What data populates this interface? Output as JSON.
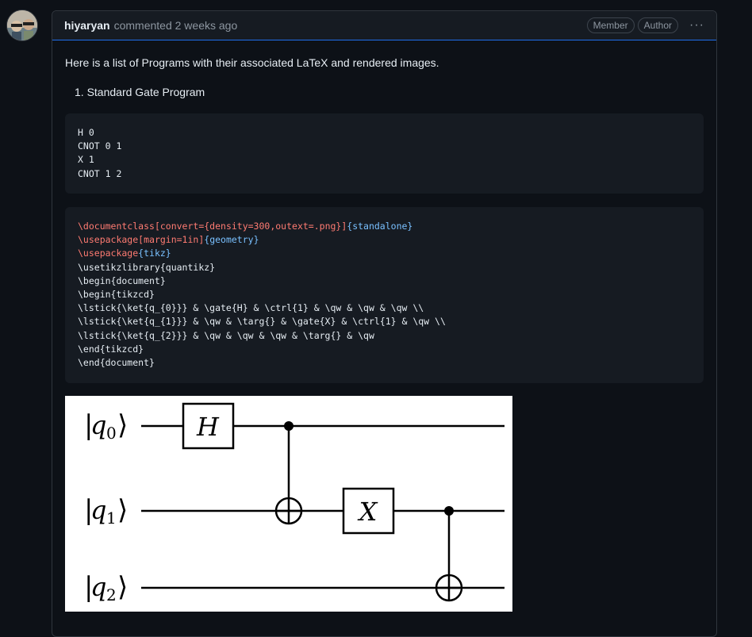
{
  "comment": {
    "author": "hiyaryan",
    "action": "commented 2 weeks ago",
    "badges": [
      "Member",
      "Author"
    ],
    "menu_icon": "kebab-horizontal-icon"
  },
  "body": {
    "intro": "Here is a list of Programs with their associated LaTeX and rendered images.",
    "list_item": "1. Standard Gate Program",
    "program_lines": [
      "H 0",
      "CNOT 0 1",
      "X 1",
      "CNOT 1 2"
    ]
  },
  "latex": {
    "l1_cmd": "\\documentclass",
    "l1_opt": "[convert={density=300,outext=.png}]",
    "l1_arg": "{standalone}",
    "l2_cmd": "\\usepackage",
    "l2_opt": "[margin=1in]",
    "l2_arg": "{geometry}",
    "l3_cmd": "\\usepackage",
    "l3_arg": "{tikz}",
    "l4": "\\usetikzlibrary{quantikz}",
    "l5": "\\begin{document}",
    "l6": "\\begin{tikzcd}",
    "l7": "\\lstick{\\ket{q_{0}}} & \\gate{H} & \\ctrl{1} & \\qw & \\qw & \\qw \\\\",
    "l8": "\\lstick{\\ket{q_{1}}} & \\qw & \\targ{} & \\gate{X} & \\ctrl{1} & \\qw \\\\",
    "l9": "\\lstick{\\ket{q_{2}}} & \\qw & \\qw & \\qw & \\targ{} & \\qw",
    "l10": "\\end{tikzcd}",
    "l11": "\\end{document}"
  },
  "circuit": {
    "qubits": [
      "q0",
      "q1",
      "q2"
    ],
    "gate_labels": [
      "H",
      "X"
    ],
    "wire_glyphs": {
      "bar": "|",
      "rangle": "⟩",
      "subs": [
        "0",
        "1",
        "2"
      ],
      "q": "q"
    }
  }
}
